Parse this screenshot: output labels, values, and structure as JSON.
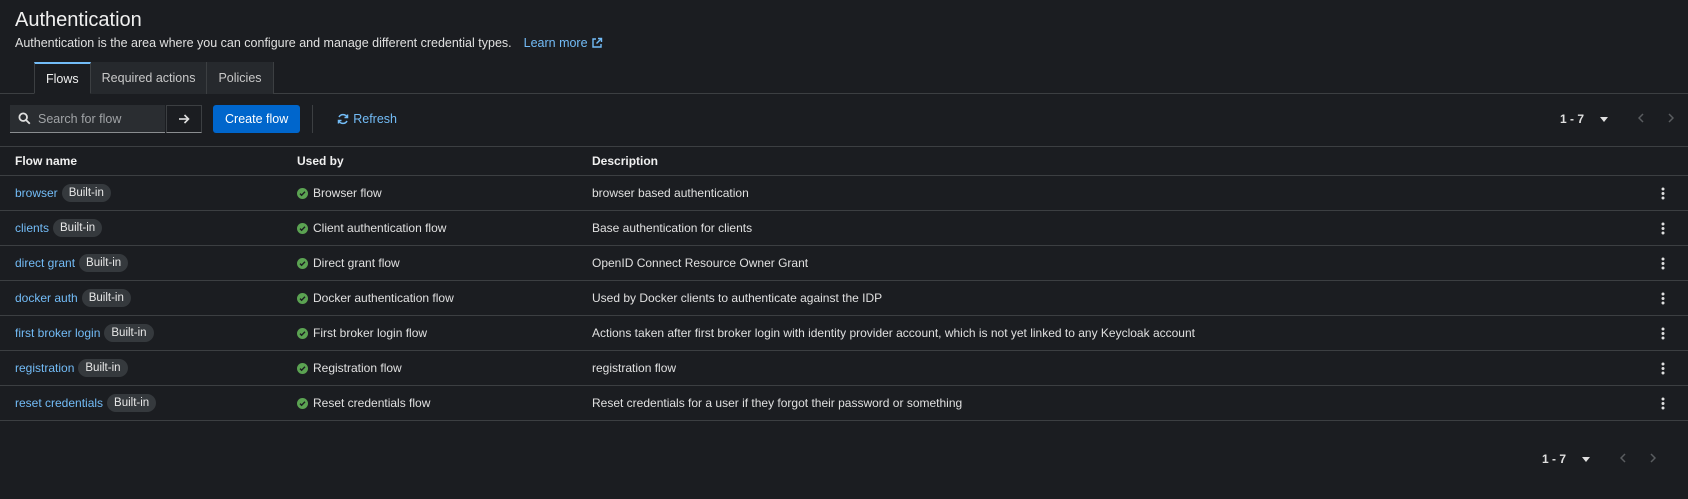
{
  "header": {
    "title": "Authentication",
    "subtitle": "Authentication is the area where you can configure and manage different credential types.",
    "learn_more": "Learn more"
  },
  "tabs": [
    {
      "label": "Flows",
      "active": true
    },
    {
      "label": "Required actions",
      "active": false
    },
    {
      "label": "Policies",
      "active": false
    }
  ],
  "toolbar": {
    "search_placeholder": "Search for flow",
    "create_label": "Create flow",
    "refresh_label": "Refresh"
  },
  "pagination": {
    "range": "1 - 7"
  },
  "table": {
    "columns": [
      "Flow name",
      "Used by",
      "Description"
    ],
    "badge_label": "Built-in",
    "rows": [
      {
        "name": "browser",
        "used_by": "Browser flow",
        "description": "browser based authentication"
      },
      {
        "name": "clients",
        "used_by": "Client authentication flow",
        "description": "Base authentication for clients"
      },
      {
        "name": "direct grant",
        "used_by": "Direct grant flow",
        "description": "OpenID Connect Resource Owner Grant"
      },
      {
        "name": "docker auth",
        "used_by": "Docker authentication flow",
        "description": "Used by Docker clients to authenticate against the IDP"
      },
      {
        "name": "first broker login",
        "used_by": "First broker login flow",
        "description": "Actions taken after first broker login with identity provider account, which is not yet linked to any Keycloak account"
      },
      {
        "name": "registration",
        "used_by": "Registration flow",
        "description": "registration flow"
      },
      {
        "name": "reset credentials",
        "used_by": "Reset credentials flow",
        "description": "Reset credentials for a user if they forgot their password or something"
      }
    ]
  },
  "colors": {
    "background": "#1b1d21",
    "link": "#73bcf7",
    "primary_button": "#0066cc",
    "success": "#5ba352"
  }
}
